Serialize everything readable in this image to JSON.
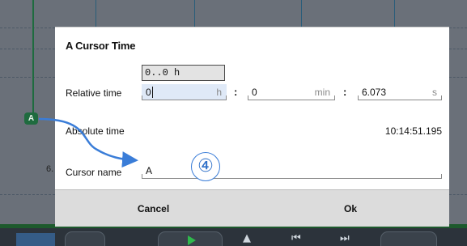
{
  "background": {
    "cursor_badge": "A",
    "left_value": "6."
  },
  "dialog": {
    "title": "A Cursor Time",
    "tooltip": "0..0 h",
    "relative_time": {
      "label": "Relative time",
      "hours": {
        "value": "0",
        "unit": "h"
      },
      "separator_1": ":",
      "minutes": {
        "value": "0",
        "unit": "min"
      },
      "separator_2": ":",
      "seconds": {
        "value": "6.073",
        "unit": "s"
      }
    },
    "absolute_time": {
      "label": "Absolute time",
      "value": "10:14:51.195"
    },
    "cursor_name": {
      "label": "Cursor name",
      "value": "A"
    },
    "step_marker": "④",
    "buttons": {
      "cancel": "Cancel",
      "ok": "Ok"
    }
  },
  "colors": {
    "accent": "#3a7dd8",
    "cursor_green": "#1f6b3f",
    "play_green": "#2fb84c"
  }
}
